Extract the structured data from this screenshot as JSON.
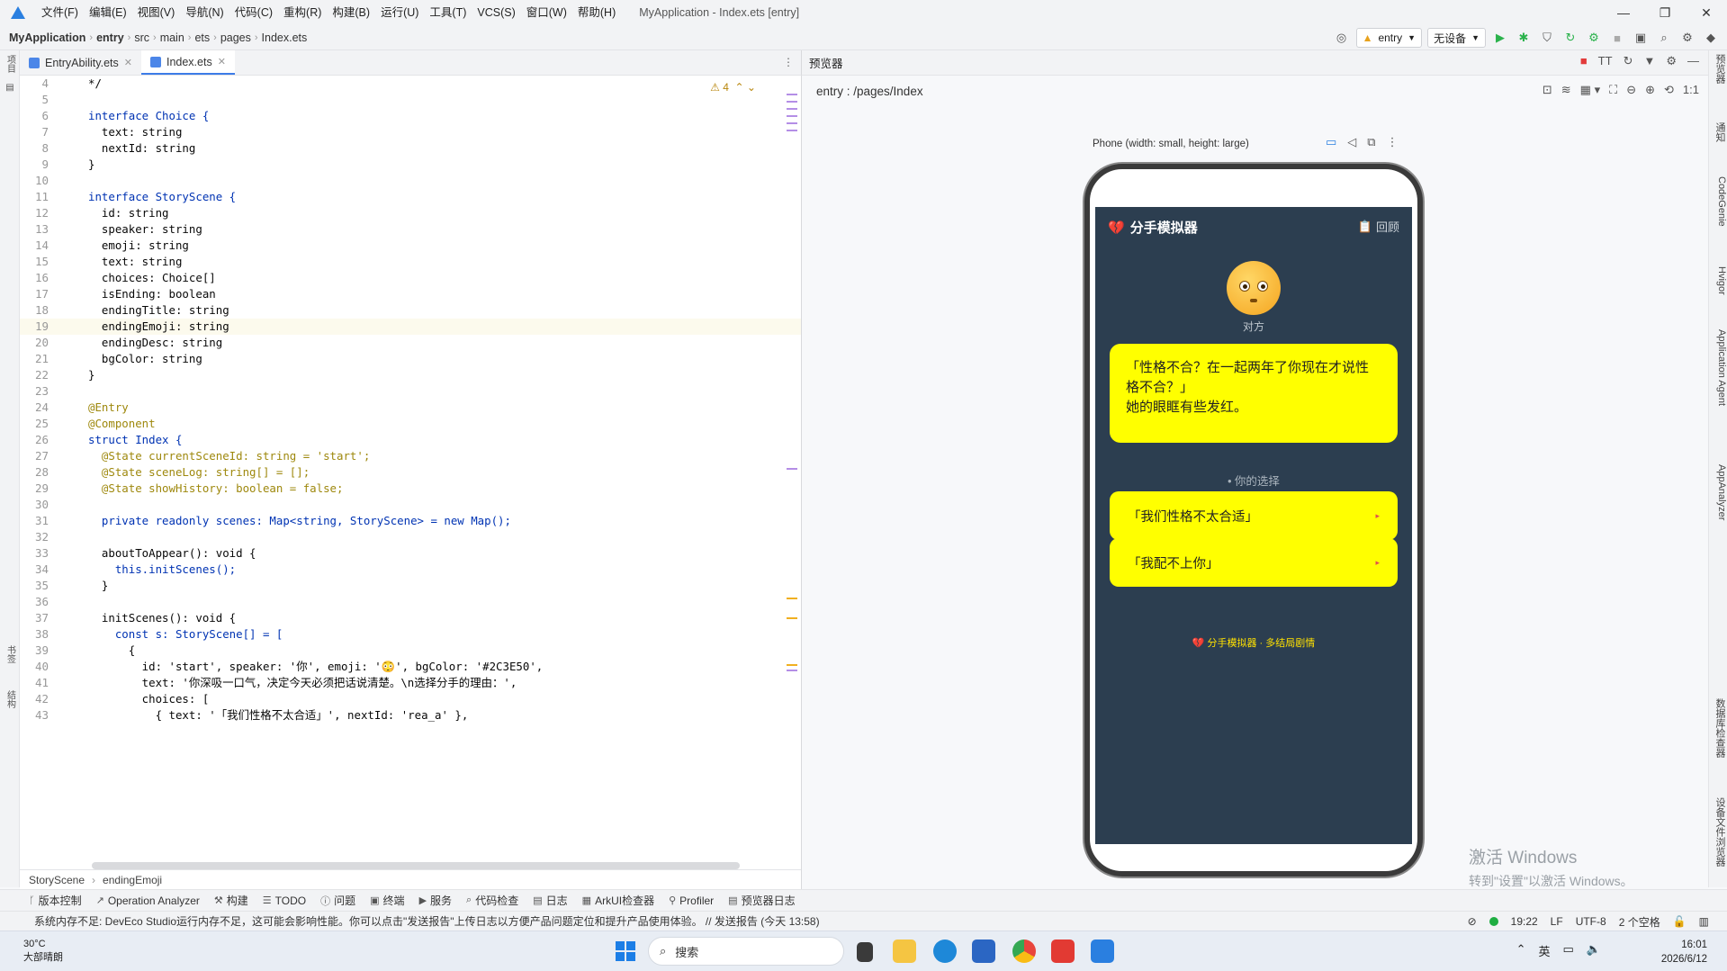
{
  "menubar": {
    "items": [
      "文件(F)",
      "编辑(E)",
      "视图(V)",
      "导航(N)",
      "代码(C)",
      "重构(R)",
      "构建(B)",
      "运行(U)",
      "工具(T)",
      "VCS(S)",
      "窗口(W)",
      "帮助(H)"
    ],
    "window_title": "MyApplication - Index.ets [entry]"
  },
  "navbar": {
    "crumbs": [
      "MyApplication",
      "entry",
      "src",
      "main",
      "ets",
      "pages",
      "Index.ets"
    ],
    "module_select": "entry",
    "device_select": "无设备"
  },
  "left_strip": {
    "project": "项目",
    "bookmarks": "书签",
    "structure": "结构"
  },
  "editor": {
    "tabs": [
      {
        "label": "EntryAbility.ets",
        "active": false
      },
      {
        "label": "Index.ets",
        "active": true
      }
    ],
    "warnings": "4",
    "lines": [
      {
        "n": "4",
        "code": "*/"
      },
      {
        "n": "5",
        "code": ""
      },
      {
        "n": "6",
        "code": "interface Choice {"
      },
      {
        "n": "7",
        "code": "  text: string"
      },
      {
        "n": "8",
        "code": "  nextId: string"
      },
      {
        "n": "9",
        "code": "}"
      },
      {
        "n": "10",
        "code": ""
      },
      {
        "n": "11",
        "code": "interface StoryScene {"
      },
      {
        "n": "12",
        "code": "  id: string"
      },
      {
        "n": "13",
        "code": "  speaker: string"
      },
      {
        "n": "14",
        "code": "  emoji: string"
      },
      {
        "n": "15",
        "code": "  text: string"
      },
      {
        "n": "16",
        "code": "  choices: Choice[]"
      },
      {
        "n": "17",
        "code": "  isEnding: boolean"
      },
      {
        "n": "18",
        "code": "  endingTitle: string"
      },
      {
        "n": "19",
        "code": "  endingEmoji: string"
      },
      {
        "n": "20",
        "code": "  endingDesc: string"
      },
      {
        "n": "21",
        "code": "  bgColor: string"
      },
      {
        "n": "22",
        "code": "}"
      },
      {
        "n": "23",
        "code": ""
      },
      {
        "n": "24",
        "code": "@Entry"
      },
      {
        "n": "25",
        "code": "@Component"
      },
      {
        "n": "26",
        "code": "struct Index {"
      },
      {
        "n": "27",
        "code": "  @State currentSceneId: string = 'start';"
      },
      {
        "n": "28",
        "code": "  @State sceneLog: string[] = [];"
      },
      {
        "n": "29",
        "code": "  @State showHistory: boolean = false;"
      },
      {
        "n": "30",
        "code": ""
      },
      {
        "n": "31",
        "code": "  private readonly scenes: Map<string, StoryScene> = new Map();"
      },
      {
        "n": "32",
        "code": ""
      },
      {
        "n": "33",
        "code": "  aboutToAppear(): void {"
      },
      {
        "n": "34",
        "code": "    this.initScenes();"
      },
      {
        "n": "35",
        "code": "  }"
      },
      {
        "n": "36",
        "code": ""
      },
      {
        "n": "37",
        "code": "  initScenes(): void {"
      },
      {
        "n": "38",
        "code": "    const s: StoryScene[] = ["
      },
      {
        "n": "39",
        "code": "      {"
      },
      {
        "n": "40",
        "code": "        id: 'start', speaker: '你', emoji: '😳', bgColor: '#2C3E50',"
      },
      {
        "n": "41",
        "code": "        text: '你深吸一口气，决定今天必须把话说清楚。\\n选择分手的理由：',"
      },
      {
        "n": "42",
        "code": "        choices: ["
      },
      {
        "n": "43",
        "code": "          { text: '「我们性格不太合适」', nextId: 'rea_a' },"
      }
    ],
    "crumbs": [
      "StoryScene",
      "endingEmoji"
    ]
  },
  "preview": {
    "title": "预览器",
    "path": "entry : /pages/Index",
    "device_label": "Phone (width: small, height: large)",
    "app": {
      "title": "分手模拟器",
      "history_label": "回顾",
      "speaker": "对方",
      "dialog_line1": "「性格不合？在一起两年了你现在才说性",
      "dialog_line2": "格不合？」",
      "dialog_line3": "她的眼眶有些发红。",
      "choice_header": "• 你的选择",
      "choices": [
        "「我们性格不太合适」",
        "「我配不上你」"
      ],
      "footer": "分手模拟器 · 多结局剧情",
      "bg_color": "#2C3E50",
      "bubble_color": "#FFFF00"
    }
  },
  "right_strip": [
    "预览器",
    "通知",
    "CodeGenie",
    "Hvigor",
    "Application Agent",
    "AppAnalyzer",
    "数据库检查器",
    "设备文件浏览器"
  ],
  "activation": {
    "line1": "激活 Windows",
    "line2": "转到\"设置\"以激活 Windows。"
  },
  "toolwindows": [
    "版本控制",
    "Operation Analyzer",
    "构建",
    "TODO",
    "问题",
    "终端",
    "服务",
    "代码检查",
    "日志",
    "ArkUI检查器",
    "Profiler",
    "预览器日志"
  ],
  "statusbar": {
    "message": "系统内存不足: DevEco Studio运行内存不足，这可能会影响性能。你可以点击\"发送报告\"上传日志以方便产品问题定位和提升产品使用体验。 // 发送报告 (今天 13:58)",
    "position": "19:22",
    "line_sep": "LF",
    "encoding": "UTF-8",
    "indent": "2 个空格"
  },
  "taskbar": {
    "temp": "30°C",
    "weather": "大部晴朗",
    "search": "搜索",
    "ime": "英",
    "time": "16:01",
    "date": "2026/6/12"
  }
}
